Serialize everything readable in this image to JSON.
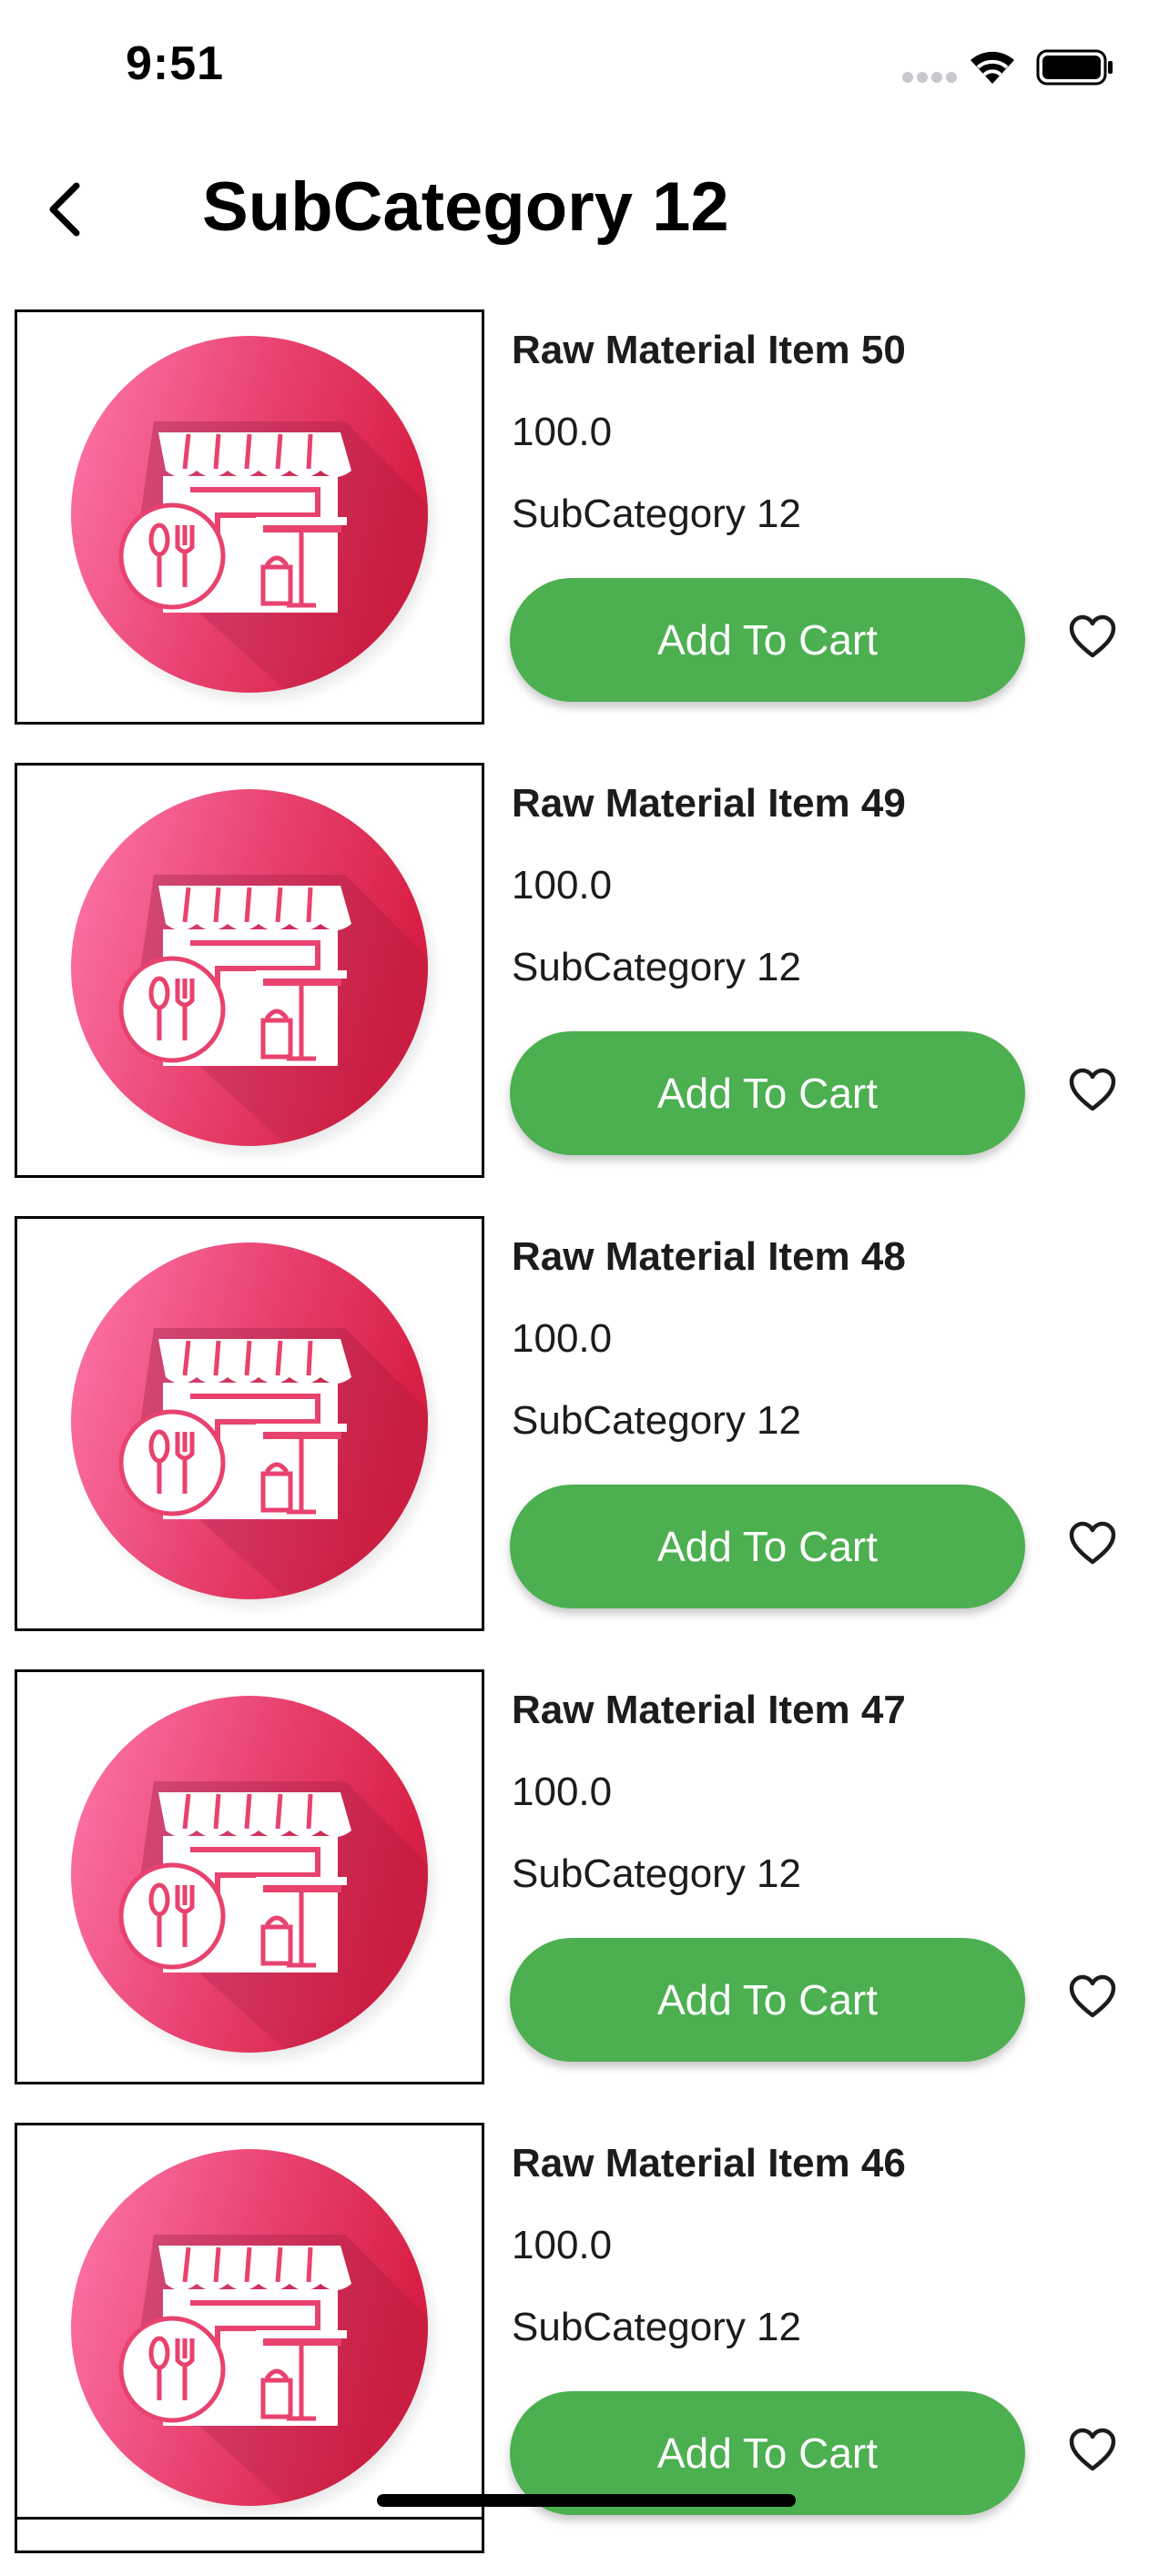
{
  "status_bar": {
    "time": "9:51",
    "icons": [
      "signal-icon",
      "wifi-icon",
      "battery-icon"
    ]
  },
  "nav": {
    "back_icon": "chevron-left-icon",
    "title": "SubCategory 12"
  },
  "colors": {
    "button_green": "#4caf50",
    "thumb_pink": "#e8426f",
    "text": "#1c1c1e"
  },
  "items": [
    {
      "name": "Raw Material Item 50",
      "price": "100.0",
      "category": "SubCategory 12",
      "button": "Add To Cart",
      "favorite_icon": "heart-outline-icon"
    },
    {
      "name": "Raw Material Item 49",
      "price": "100.0",
      "category": "SubCategory 12",
      "button": "Add To Cart",
      "favorite_icon": "heart-outline-icon"
    },
    {
      "name": "Raw Material Item 48",
      "price": "100.0",
      "category": "SubCategory 12",
      "button": "Add To Cart",
      "favorite_icon": "heart-outline-icon"
    },
    {
      "name": "Raw Material Item 47",
      "price": "100.0",
      "category": "SubCategory 12",
      "button": "Add To Cart",
      "favorite_icon": "heart-outline-icon"
    },
    {
      "name": "Raw Material Item 46",
      "price": "100.0",
      "category": "SubCategory 12",
      "button": "Add To Cart",
      "favorite_icon": "heart-outline-icon"
    }
  ]
}
